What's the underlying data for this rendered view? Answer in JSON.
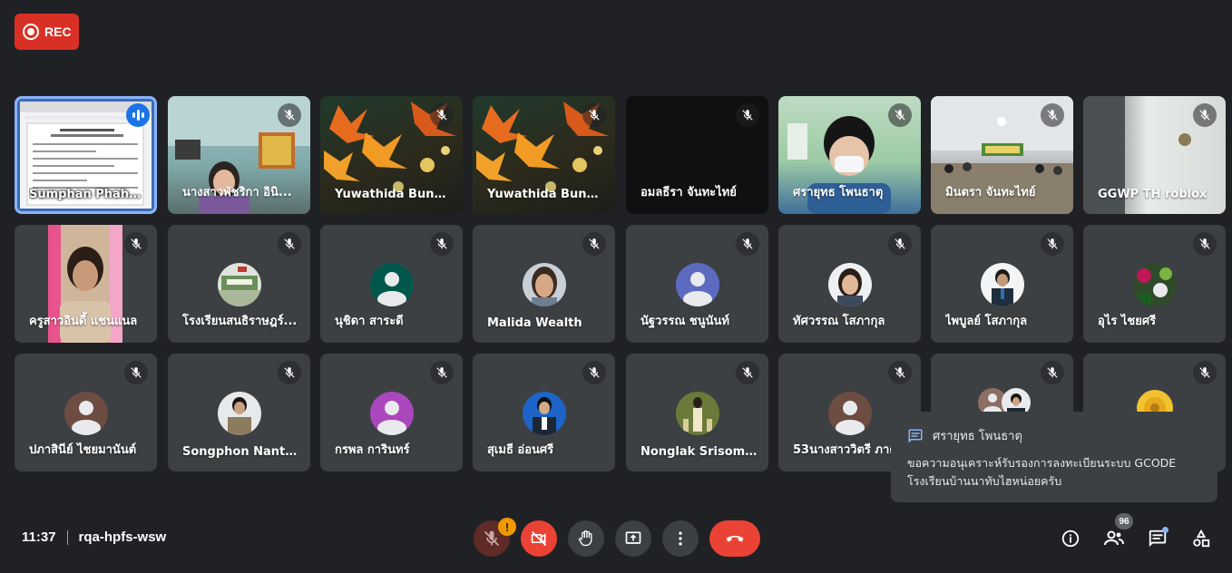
{
  "recording": {
    "label": "REC"
  },
  "meeting": {
    "time": "11:37",
    "code": "rqa-hpfs-wsw"
  },
  "participants_row1": [
    {
      "name": "Sumphan Phahp...",
      "muted": false,
      "speaking": true
    },
    {
      "name": "นางสาวพัชริกา อินิ...",
      "muted": true
    },
    {
      "name": "Yuwathida Bunk...",
      "muted": true
    },
    {
      "name": "Yuwathida Bunk...",
      "muted": true
    },
    {
      "name": "อมลธีรา จันทะไทย์",
      "muted": true
    },
    {
      "name": "ศรายุทธ โพนธาตุ",
      "muted": true
    },
    {
      "name": "มินตรา จันทะไทย์",
      "muted": true
    },
    {
      "name": "GGWP TH roblox",
      "muted": true
    }
  ],
  "participants_row2": [
    {
      "name": "ครูสาวอินดี้ แชนแนล",
      "muted": true
    },
    {
      "name": "โรงเรียนสนธิราษฎร์...",
      "muted": true
    },
    {
      "name": "นุชิดา สาระดี",
      "muted": true
    },
    {
      "name": "Malida Wealth",
      "muted": true
    },
    {
      "name": "นัฐวรรณ ชนูนันท์",
      "muted": true
    },
    {
      "name": "ทัศวรรณ โสภากุล",
      "muted": true
    },
    {
      "name": "ไพบูลย์ โสภากุล",
      "muted": true
    },
    {
      "name": "อุไร ไชยศรี",
      "muted": true
    }
  ],
  "participants_row3": [
    {
      "name": "ปภาสินีย์ ไชยมานันต์",
      "muted": true
    },
    {
      "name": "Songphon Nanth...",
      "muted": true
    },
    {
      "name": "กรพล การินทร์",
      "muted": true
    },
    {
      "name": "สุเมธี อ่อนศรี",
      "muted": true
    },
    {
      "name": "Nonglak Srisomb...",
      "muted": true
    },
    {
      "name": "53นางสาววิตรี ภาคี",
      "muted": true
    },
    {
      "name": "",
      "muted": true
    },
    {
      "name": "",
      "muted": true
    }
  ],
  "chat_toast": {
    "sender": "ศรายุทธ โพนธาตุ",
    "message_line1": "ขอความอนุเคราะห์รับรองการลงทะเบียนระบบ GCODE",
    "message_line2": "โรงเรียนบ้านนาทับไฮหน่อยครับ"
  },
  "controls": {
    "mic_warning": "!",
    "people_count": "96"
  },
  "colors": {
    "background": "#202124",
    "tile": "#3c4043",
    "red": "#ea4335",
    "accent": "#8ab4f8"
  }
}
